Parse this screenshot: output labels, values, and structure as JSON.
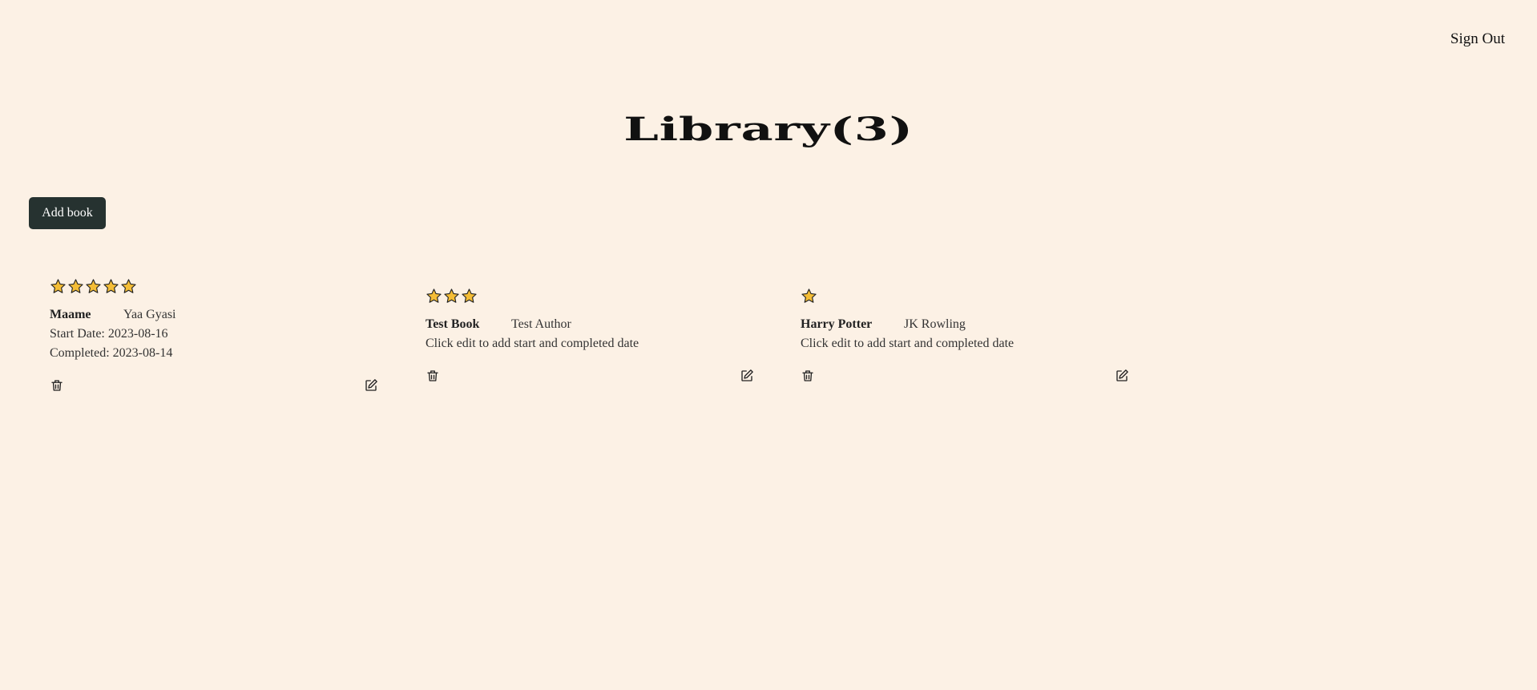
{
  "header": {
    "signout_label": "Sign Out",
    "title": "Library(3)"
  },
  "toolbar": {
    "add_book_label": "Add book"
  },
  "colors": {
    "background": "#fcf1e5",
    "button_bg": "#263230",
    "star_fill": "#f4bd36",
    "star_stroke": "#222222"
  },
  "books": [
    {
      "rating": 5,
      "title": "Maame",
      "author": "Yaa Gyasi",
      "lines": [
        "Start Date: 2023-08-16",
        "Completed: 2023-08-14"
      ],
      "delete_icon": "trash-icon",
      "edit_icon": "edit-icon"
    },
    {
      "rating": 3,
      "title": "Test Book",
      "author": "Test Author",
      "lines": [
        "Click edit to add start and completed date"
      ],
      "delete_icon": "trash-icon",
      "edit_icon": "edit-icon"
    },
    {
      "rating": 1,
      "title": "Harry Potter",
      "author": "JK Rowling",
      "lines": [
        "Click edit to add start and completed date"
      ],
      "delete_icon": "trash-icon",
      "edit_icon": "edit-icon"
    }
  ]
}
